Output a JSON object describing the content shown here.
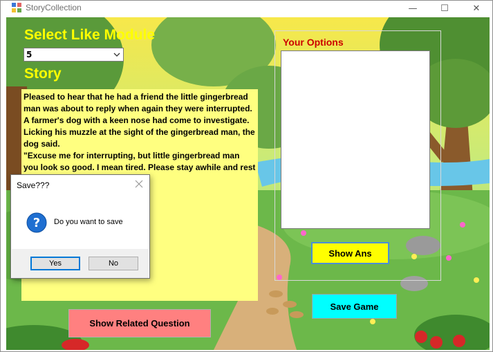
{
  "window": {
    "title": "StoryCollection",
    "minimize_glyph": "—",
    "maximize_glyph": "☐",
    "close_glyph": "✕"
  },
  "main": {
    "select_module_label": "Select Like Module",
    "module_value": "5",
    "story_label": "Story",
    "story_text": "Pleased to hear that he had a friend the little gingerbread man was about to reply when again they were interrupted. A farmer's dog with a keen nose had come to investigate. Licking his muzzle at the sight of the gingerbread man, the dog said.\n\"Excuse me for interrupting, but little gingerbread man you look so good. I mean tired. Please stay awhile and rest if",
    "options_label": "Your Options",
    "show_ans_label": "Show Ans",
    "save_game_label": "Save Game",
    "show_related_label": "Show Related Question"
  },
  "dialog": {
    "title": "Save???",
    "message": "Do you want to save",
    "yes_label": "Yes",
    "no_label": "No",
    "icon": "question-icon"
  }
}
